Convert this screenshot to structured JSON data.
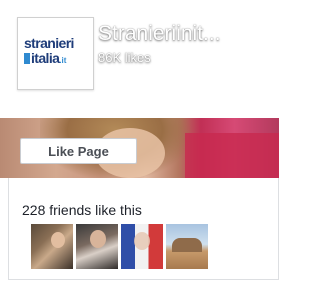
{
  "page": {
    "name": "Stranieriinit...",
    "likes": "86K likes"
  },
  "logo": {
    "line1": "stranieri",
    "line2": "italia",
    "tld": ".it"
  },
  "actions": {
    "like_page_label": "Like Page"
  },
  "friends": {
    "summary": "228 friends like this",
    "avatars": [
      "friend-avatar",
      "friend-avatar",
      "friend-avatar",
      "friend-avatar"
    ]
  },
  "colors": {
    "logo_text": "#1f3d7a",
    "logo_accent": "#2f8ad0",
    "button_border": "#c9ccd1",
    "panel_border": "#dddfe2"
  }
}
